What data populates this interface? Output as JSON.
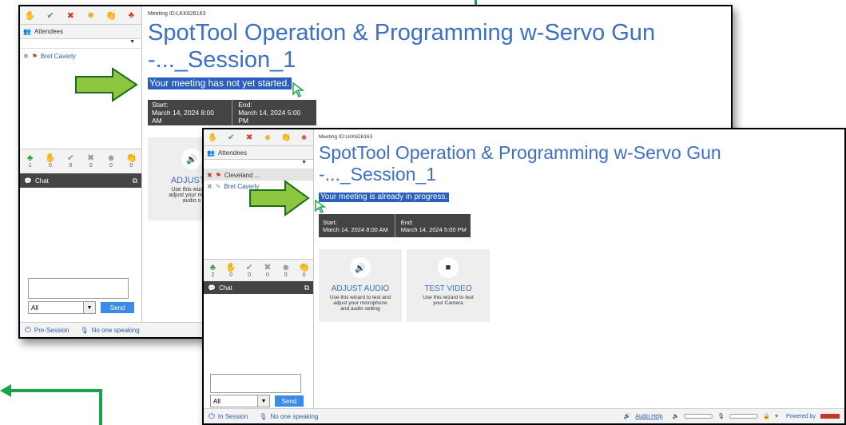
{
  "back_window": {
    "meeting_id": "Meeting ID:LKK626163",
    "title_line1": "SpotTool Operation & Programming w-Servo Gun",
    "title_line2": "-..._Session_1",
    "status": "Your meeting has not yet started.",
    "start_label": "Start:",
    "start_value": "March 14, 2024 8:00 AM",
    "end_label": "End:",
    "end_value": "March 14, 2024 5:00 PM",
    "attendees_label": "Attendees",
    "attendees": [
      "Bret Caverly"
    ],
    "stat_counts": [
      "1",
      "0",
      "0",
      "0",
      "0",
      "0"
    ],
    "chat_label": "Chat",
    "select_value": "All",
    "send_label": "Send",
    "session_status": "Pre-Session",
    "speaking_status": "No one speaking",
    "adjust_title": "ADJUST A",
    "adjust_desc": "Use this wizard t adjust your mi and audio s"
  },
  "front_window": {
    "meeting_id": "Meeting ID:LKK626163",
    "title_line1": "SpotTool Operation & Programming w-Servo Gun",
    "title_line2": "-..._Session_1",
    "status": "Your meeting is already in progress.",
    "start_label": "Start:",
    "start_value": "March 14, 2024 8:00 AM",
    "end_label": "End:",
    "end_value": "March 14, 2024 5:00 PM",
    "attendees_label": "Attendees",
    "attendees": [
      "Cleveland ...",
      "Bret Caverly"
    ],
    "stat_counts": [
      "2",
      "0",
      "0",
      "0",
      "0",
      "0"
    ],
    "chat_label": "Chat",
    "select_value": "All",
    "send_label": "Send",
    "session_status": "In Session",
    "speaking_status": "No one speaking",
    "audio_card": {
      "title": "ADJUST AUDIO",
      "desc": "Use this wizard to test and adjust your microphone and audio setting"
    },
    "video_card": {
      "title": "TEST VIDEO",
      "desc": "Use this wizard to test your Camera"
    },
    "audio_help": "Audio Help",
    "powered_by": "Powered by"
  },
  "icons": [
    "raise-hand-icon",
    "check-icon",
    "x-icon",
    "emoji-icon",
    "applause-icon",
    "people-icon",
    "speaker-icon",
    "camera-icon",
    "microphone-icon",
    "lock-icon",
    "signal-icon"
  ],
  "colors": {
    "title_blue": "#3d6fc4",
    "status_highlight": "#2a5fbf",
    "arrow_green": "#8dc63f",
    "arrow_outline": "#1e6b1e",
    "connector_green": "#1aa34a"
  }
}
